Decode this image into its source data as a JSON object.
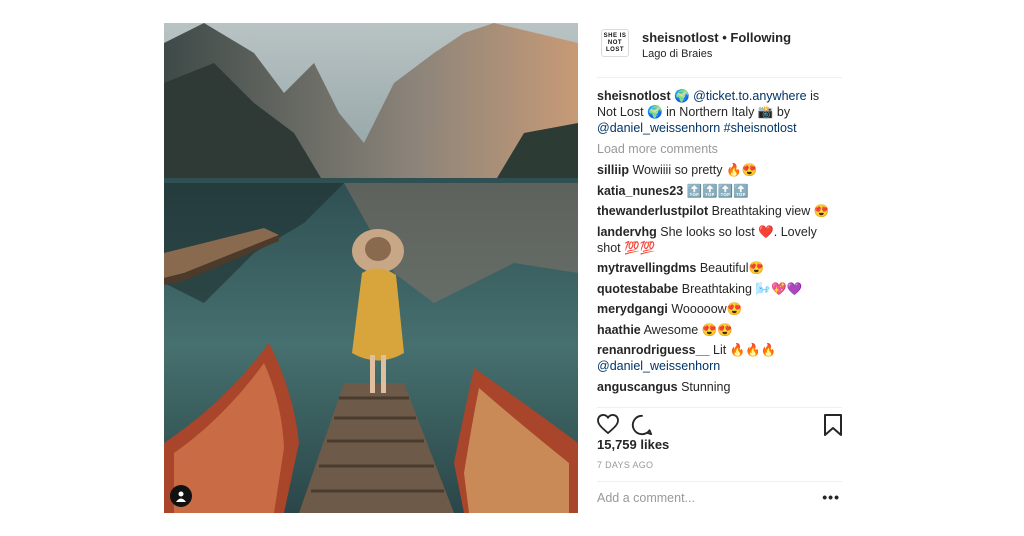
{
  "post": {
    "username": "sheisnotlost",
    "separator": "•",
    "follow_status": "Following",
    "location": "Lago di Braies",
    "avatar_text": [
      "SHE IS",
      "NOT",
      "LOST"
    ],
    "caption": {
      "username": "sheisnotlost",
      "globe1": "🌍",
      "mention": "@ticket.to.anywhere",
      "text1": "is Not Lost",
      "globe2": "🌍",
      "text2": "in Northern Italy",
      "camera": "📸",
      "text3": "by",
      "mention2": "@daniel_weissenhorn",
      "hashtag": "#sheisnotlost"
    },
    "load_more": "Load more comments",
    "comments": [
      {
        "user": "silliip",
        "text": "Wowiiii so pretty 🔥😍"
      },
      {
        "user": "katia_nunes23",
        "text": "🔝🔝🔝🔝"
      },
      {
        "user": "thewanderlustpilot",
        "text": "Breathtaking view 😍"
      },
      {
        "user": "landervhg",
        "text": "She looks so lost ❤️. Lovely shot 💯💯"
      },
      {
        "user": "mytravellingdms",
        "text": "Beautiful😍"
      },
      {
        "user": "quotestababe",
        "text": "Breathtaking 🌬️💖💜"
      },
      {
        "user": "merydgangi",
        "text": "Wooooow😍"
      },
      {
        "user": "haathie",
        "text": "Awesome 😍😍"
      },
      {
        "user": "renanrodriguess__",
        "text": "Lit 🔥🔥🔥",
        "mention": "@daniel_weissenhorn"
      },
      {
        "user": "anguscangus",
        "text": "Stunning"
      }
    ],
    "likes": "15,759 likes",
    "time_ago": "7 DAYS AGO",
    "add_comment_placeholder": "Add a comment...",
    "more_options": "•••"
  },
  "icons": [
    "heart-icon",
    "comment-icon",
    "bookmark-icon",
    "user-tag-icon"
  ]
}
